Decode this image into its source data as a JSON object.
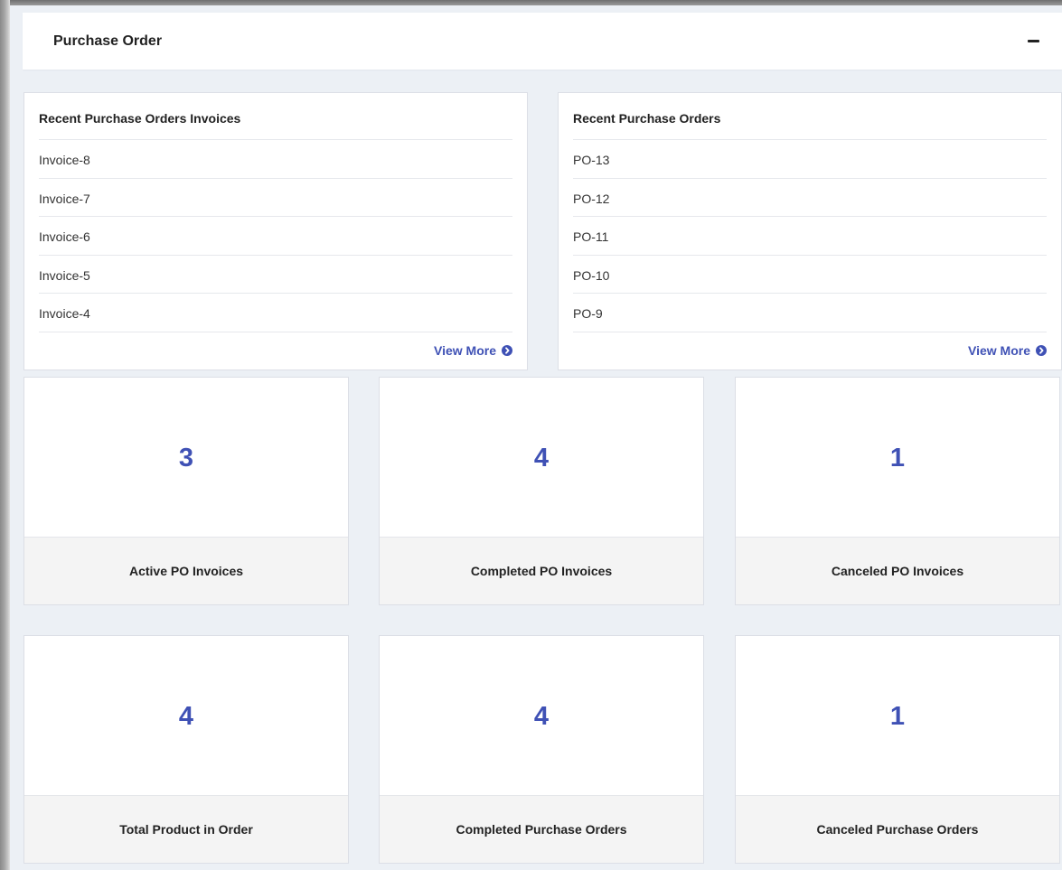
{
  "panel": {
    "title": "Purchase Order"
  },
  "recent_invoices": {
    "title": "Recent Purchase Orders Invoices",
    "items": [
      "Invoice-8",
      "Invoice-7",
      "Invoice-6",
      "Invoice-5",
      "Invoice-4"
    ],
    "view_more": "View More"
  },
  "recent_orders": {
    "title": "Recent Purchase Orders",
    "items": [
      "PO-13",
      "PO-12",
      "PO-11",
      "PO-10",
      "PO-9"
    ],
    "view_more": "View More"
  },
  "stats": [
    {
      "value": "3",
      "label": "Active PO Invoices"
    },
    {
      "value": "4",
      "label": "Completed PO Invoices"
    },
    {
      "value": "1",
      "label": "Canceled PO Invoices"
    },
    {
      "value": "4",
      "label": "Total Product in Order"
    },
    {
      "value": "4",
      "label": "Completed Purchase Orders"
    },
    {
      "value": "1",
      "label": "Canceled Purchase Orders"
    }
  ],
  "colors": {
    "accent": "#3f51b5",
    "background": "#ecf0f5",
    "label_bg": "#f4f4f4"
  }
}
